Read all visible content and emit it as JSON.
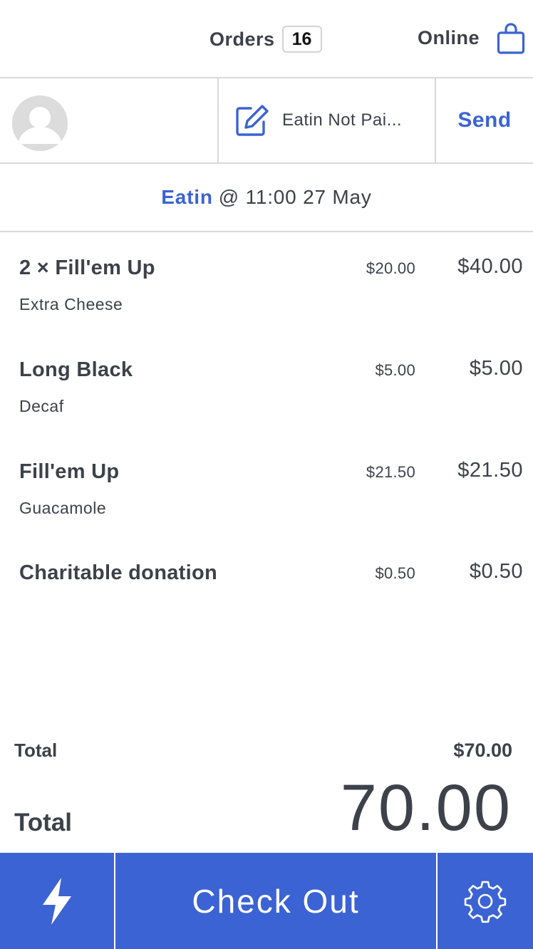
{
  "header": {
    "orders_label": "Orders",
    "orders_count": "16",
    "online_label": "Online",
    "bag_icon": "shopping-bag-icon"
  },
  "customer_row": {
    "avatar_icon": "user-avatar-icon",
    "edit_icon": "edit-note-icon",
    "note_text": "Eatin Not Pai...",
    "send_label": "Send"
  },
  "order_type": {
    "type": "Eatin",
    "time": "@ 11:00 27 May"
  },
  "items": [
    {
      "name": "2 × Fill'em Up",
      "unit_price": "$20.00",
      "total": "$40.00",
      "modifier": "Extra Cheese"
    },
    {
      "name": "Long Black",
      "unit_price": "$5.00",
      "total": "$5.00",
      "modifier": "Decaf"
    },
    {
      "name": "Fill'em Up",
      "unit_price": "$21.50",
      "total": "$21.50",
      "modifier": "Guacamole"
    },
    {
      "name": "Charitable donation",
      "unit_price": "$0.50",
      "total": "$0.50",
      "modifier": ""
    }
  ],
  "totals": {
    "label": "Total",
    "value": "$70.00",
    "big_label": "Total",
    "big_value": "70.00"
  },
  "footer": {
    "quick_icon": "lightning-bolt-icon",
    "checkout_label": "Check Out",
    "settings_icon": "gear-icon"
  },
  "colors": {
    "accent": "#3b63d3",
    "text": "#3d4149",
    "divider": "#d9d9d9"
  }
}
